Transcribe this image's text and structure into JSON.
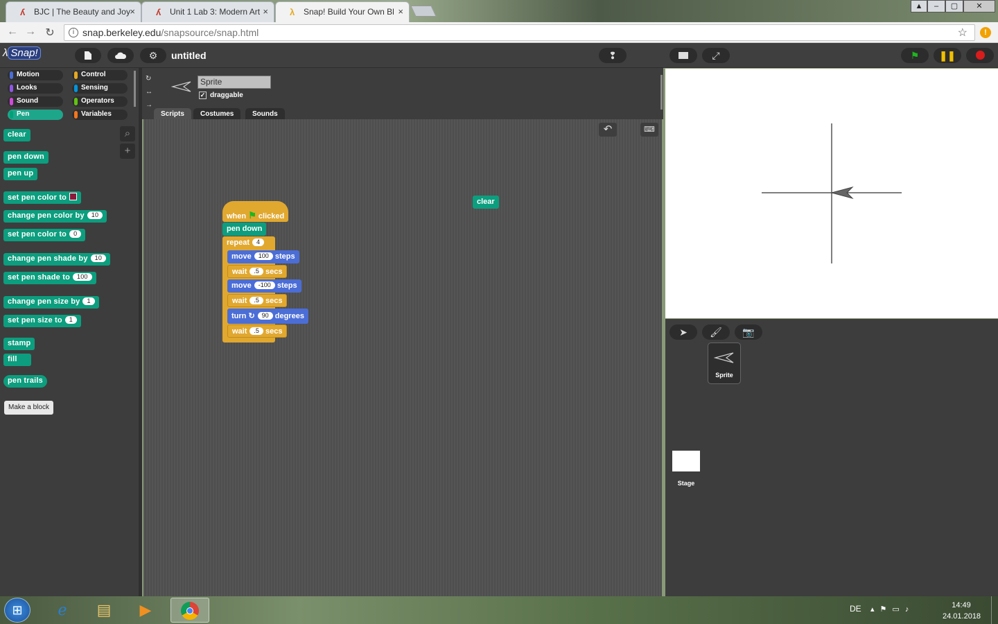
{
  "browser": {
    "tabs": [
      {
        "title": "BJC | The Beauty and Joy",
        "close": "×"
      },
      {
        "title": "Unit 1 Lab 3: Modern Art",
        "close": "×"
      },
      {
        "title": "Snap! Build Your Own Bl",
        "close": "×"
      }
    ],
    "url_host": "snap.berkeley.edu",
    "url_path": "/snapsource/snap.html"
  },
  "snap": {
    "logo": "Snap!",
    "project_title": "untitled",
    "categories": [
      {
        "label": "Motion",
        "color": "#4a6cd4"
      },
      {
        "label": "Control",
        "color": "#e6a822"
      },
      {
        "label": "Looks",
        "color": "#8f56e3"
      },
      {
        "label": "Sensing",
        "color": "#0494dc"
      },
      {
        "label": "Sound",
        "color": "#cf4ad9"
      },
      {
        "label": "Operators",
        "color": "#62c213"
      },
      {
        "label": "Pen",
        "color": "#00a178"
      },
      {
        "label": "Variables",
        "color": "#f3761d"
      }
    ],
    "palette": {
      "clear": "clear",
      "pen_down": "pen down",
      "pen_up": "pen up",
      "set_pen_color_to": "set pen color to",
      "change_pen_color_by": "change pen color by",
      "change_pen_color_val": "10",
      "set_pen_color_to_num": "set pen color to",
      "set_pen_color_num_val": "0",
      "change_pen_shade_by": "change pen shade by",
      "change_pen_shade_val": "10",
      "set_pen_shade_to": "set pen shade to",
      "set_pen_shade_val": "100",
      "change_pen_size_by": "change pen size by",
      "change_pen_size_val": "1",
      "set_pen_size_to": "set pen size to",
      "set_pen_size_val": "1",
      "stamp": "stamp",
      "fill": "fill",
      "pen_trails": "pen trails",
      "make_block": "Make a block"
    },
    "sprite": {
      "name": "Sprite",
      "draggable": "draggable"
    },
    "tabs": [
      "Scripts",
      "Costumes",
      "Sounds"
    ],
    "script": {
      "when": "when",
      "clicked": "clicked",
      "pen_down": "pen down",
      "repeat": "repeat",
      "repeat_val": "4",
      "move1": "move",
      "move1_val": "100",
      "steps1": "steps",
      "wait1": "wait",
      "wait1_val": ".5",
      "secs1": "secs",
      "move2": "move",
      "move2_val": "-100",
      "steps2": "steps",
      "wait2": "wait",
      "wait2_val": ".5",
      "secs2": "secs",
      "turn": "turn",
      "turn_val": "90",
      "degrees": "degrees",
      "wait3": "wait",
      "wait3_val": ".5",
      "secs3": "secs",
      "loose_clear": "clear"
    },
    "corral": {
      "sprite_label": "Sprite",
      "stage_label": "Stage"
    }
  },
  "taskbar": {
    "lang": "DE",
    "time": "14:49",
    "date": "24.01.2018"
  }
}
